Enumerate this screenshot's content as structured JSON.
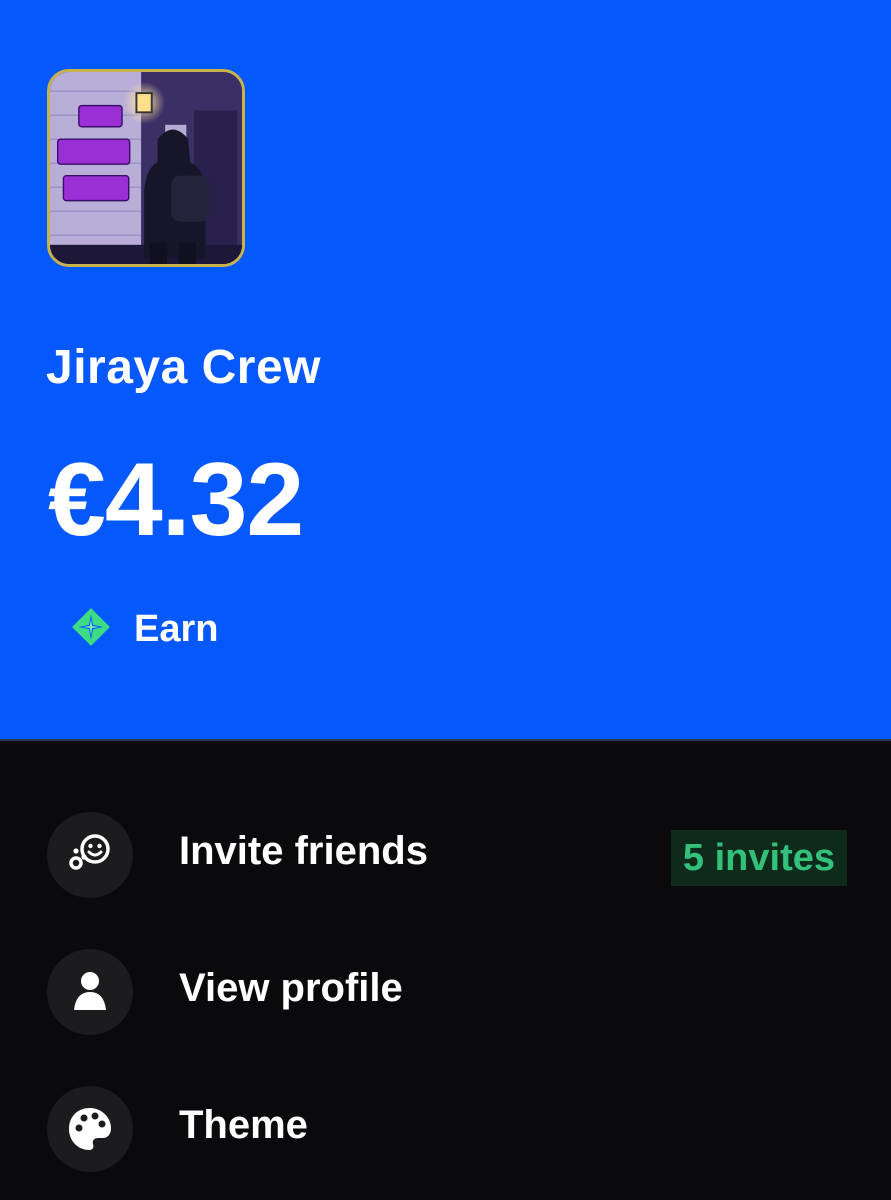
{
  "wallet": {
    "name": "Jiraya Crew",
    "balance": "€4.32",
    "avatar_alt": "THE JIRAYA CREW"
  },
  "earn": {
    "label": "Earn",
    "icon": "sparkle-diamond-icon"
  },
  "menu": {
    "items": [
      {
        "label": "Invite friends",
        "icon": "invite-friends-icon",
        "badge": "5 invites"
      },
      {
        "label": "View profile",
        "icon": "person-icon"
      },
      {
        "label": "Theme",
        "icon": "palette-icon"
      }
    ]
  },
  "colors": {
    "header_bg": "#0558fb",
    "page_bg": "#0a0a0c",
    "badge_text": "#33c07a",
    "badge_bg": "#0e2a1b",
    "earn_icon": "#3ddc84"
  }
}
